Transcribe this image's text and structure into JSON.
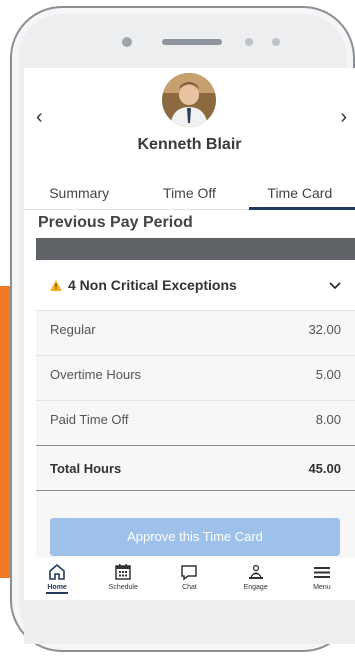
{
  "employee": {
    "name": "Kenneth Blair"
  },
  "tabs": [
    {
      "label": "Summary"
    },
    {
      "label": "Time Off"
    },
    {
      "label": "Time Card"
    }
  ],
  "active_tab": "Time Card",
  "period": {
    "title": "Previous Pay Period"
  },
  "exceptions": {
    "label": "4 Non Critical Exceptions"
  },
  "rows": [
    {
      "label": "Regular",
      "value": "32.00"
    },
    {
      "label": "Overtime Hours",
      "value": "5.00"
    },
    {
      "label": "Paid Time Off",
      "value": "8.00"
    }
  ],
  "total": {
    "label": "Total Hours",
    "value": "45.00"
  },
  "approve_button": {
    "label": "Approve this Time Card"
  },
  "bottom_nav": [
    {
      "label": "Home",
      "icon": "home-icon"
    },
    {
      "label": "Schedule",
      "icon": "calendar-icon"
    },
    {
      "label": "Chat",
      "icon": "chat-icon"
    },
    {
      "label": "Engage",
      "icon": "engage-icon"
    },
    {
      "label": "Menu",
      "icon": "menu-icon"
    }
  ],
  "colors": {
    "accent": "#233a5c",
    "warning": "#f5b321",
    "approve": "#9dc1e8",
    "side_bar": "#f07a26"
  }
}
